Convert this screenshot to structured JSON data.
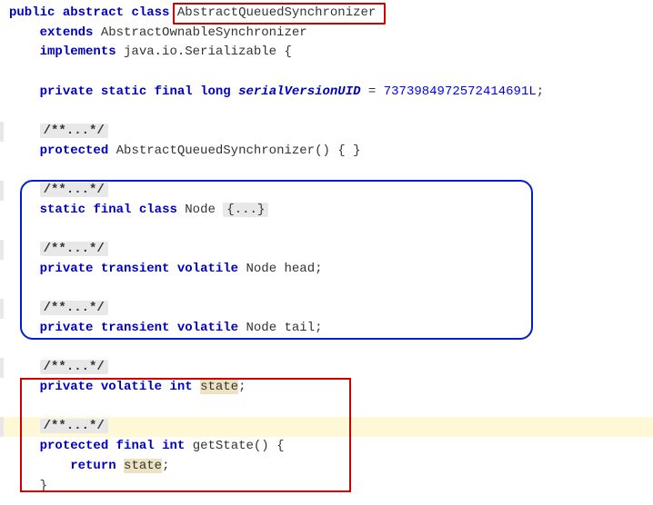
{
  "code": {
    "decl_public": "public",
    "decl_abstract": "abstract",
    "decl_class": "class",
    "class_name": "AbstractQueuedSynchronizer",
    "extends_kw": "extends",
    "extends_type": "AbstractOwnableSynchronizer",
    "implements_kw": "implements",
    "implements_type": "java.io.Serializable",
    "brace_open": "{",
    "field_private": "private",
    "field_static": "static",
    "field_final": "final",
    "field_long": "long",
    "serial_uid_name": "serialVersionUID",
    "equals": " = ",
    "serial_uid_value": "7373984972572414691L",
    "semicolon": ";",
    "javadoc_fold": "/**...*/",
    "protected_kw": "protected",
    "ctor_name": "AbstractQueuedSynchronizer",
    "ctor_sig": "() { }",
    "static_kw": "static",
    "final_kw": "final",
    "class_kw": "class",
    "node_name": "Node",
    "node_fold": "{...}",
    "private_kw": "private",
    "transient_kw": "transient",
    "volatile_kw": "volatile",
    "node_type": "Node",
    "head_name": "head",
    "tail_name": "tail",
    "int_kw": "int",
    "state_name": "state",
    "getstate_name": "getState",
    "paren_brace": "() {",
    "return_kw": "return",
    "close_brace": "}"
  }
}
